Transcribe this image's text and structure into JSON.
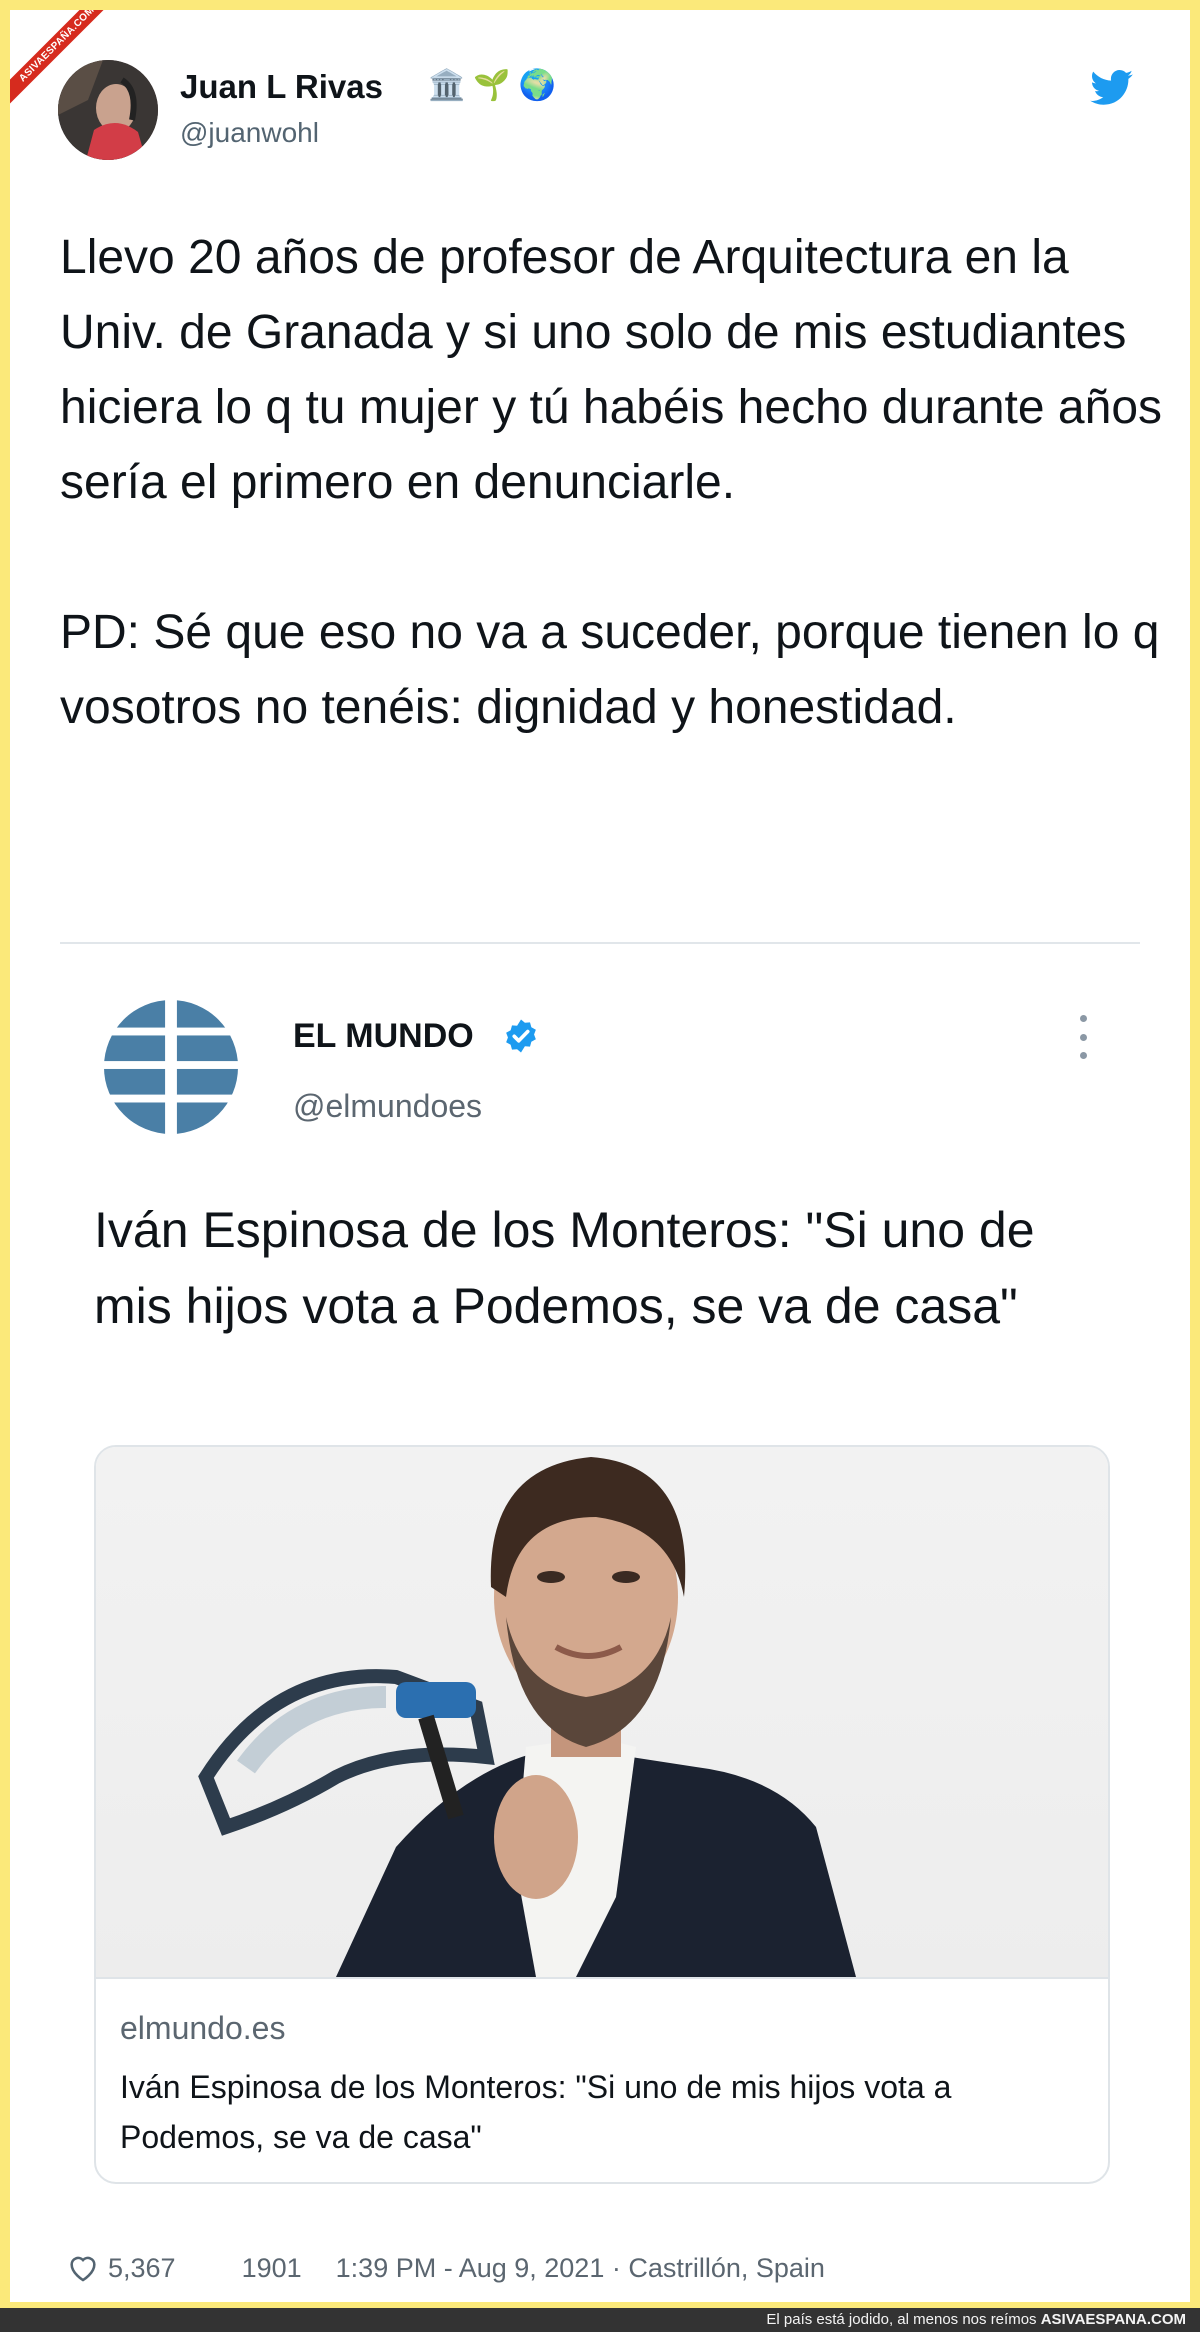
{
  "watermark": {
    "ribbon": "ASIVAESPAÑA.COM"
  },
  "tweet": {
    "author_name": "Juan L Rivas",
    "author_emojis": [
      "🏛️",
      "🌱",
      "🌍"
    ],
    "author_handle": "@juanwohl",
    "text": "Llevo 20 años de profesor de Arquitectura en la Univ. de Granada y si uno solo de mis estudiantes hiciera lo q tu mujer y tú habéis hecho durante años sería el primero en denunciarle.\n\nPD: Sé que eso no va a suceder, porque tienen lo q vosotros no tenéis: dignidad y honestidad.",
    "likes": "5,367",
    "retweets": "1901",
    "timestamp": "1:39 PM - Aug 9, 2021",
    "location": "Castrillón, Spain"
  },
  "quoted": {
    "name": "EL MUNDO",
    "handle": "@elmundoes",
    "text": "Iván Espinosa de los Monteros: \"Si uno de mis hijos vota a Podemos, se va de casa\"",
    "link": {
      "domain": "elmundo.es",
      "title": "Iván Espinosa de los Monteros: \"Si uno de mis hijos vota a Podemos, se va de casa\""
    }
  },
  "footer_caption": {
    "text": "El país está jodido, al menos nos reímos",
    "brand": "ASIVAESPANA.COM"
  },
  "colors": {
    "frame": "#fbe97a",
    "twitter_blue": "#1d9bf0",
    "elmundo_blue": "#4a7fa6",
    "text": "#0f1419",
    "secondary": "#536471"
  },
  "icons": {
    "brand": "twitter-bird-icon",
    "verified": "verified-badge-icon",
    "more": "more-options-icon",
    "like": "heart-icon"
  }
}
